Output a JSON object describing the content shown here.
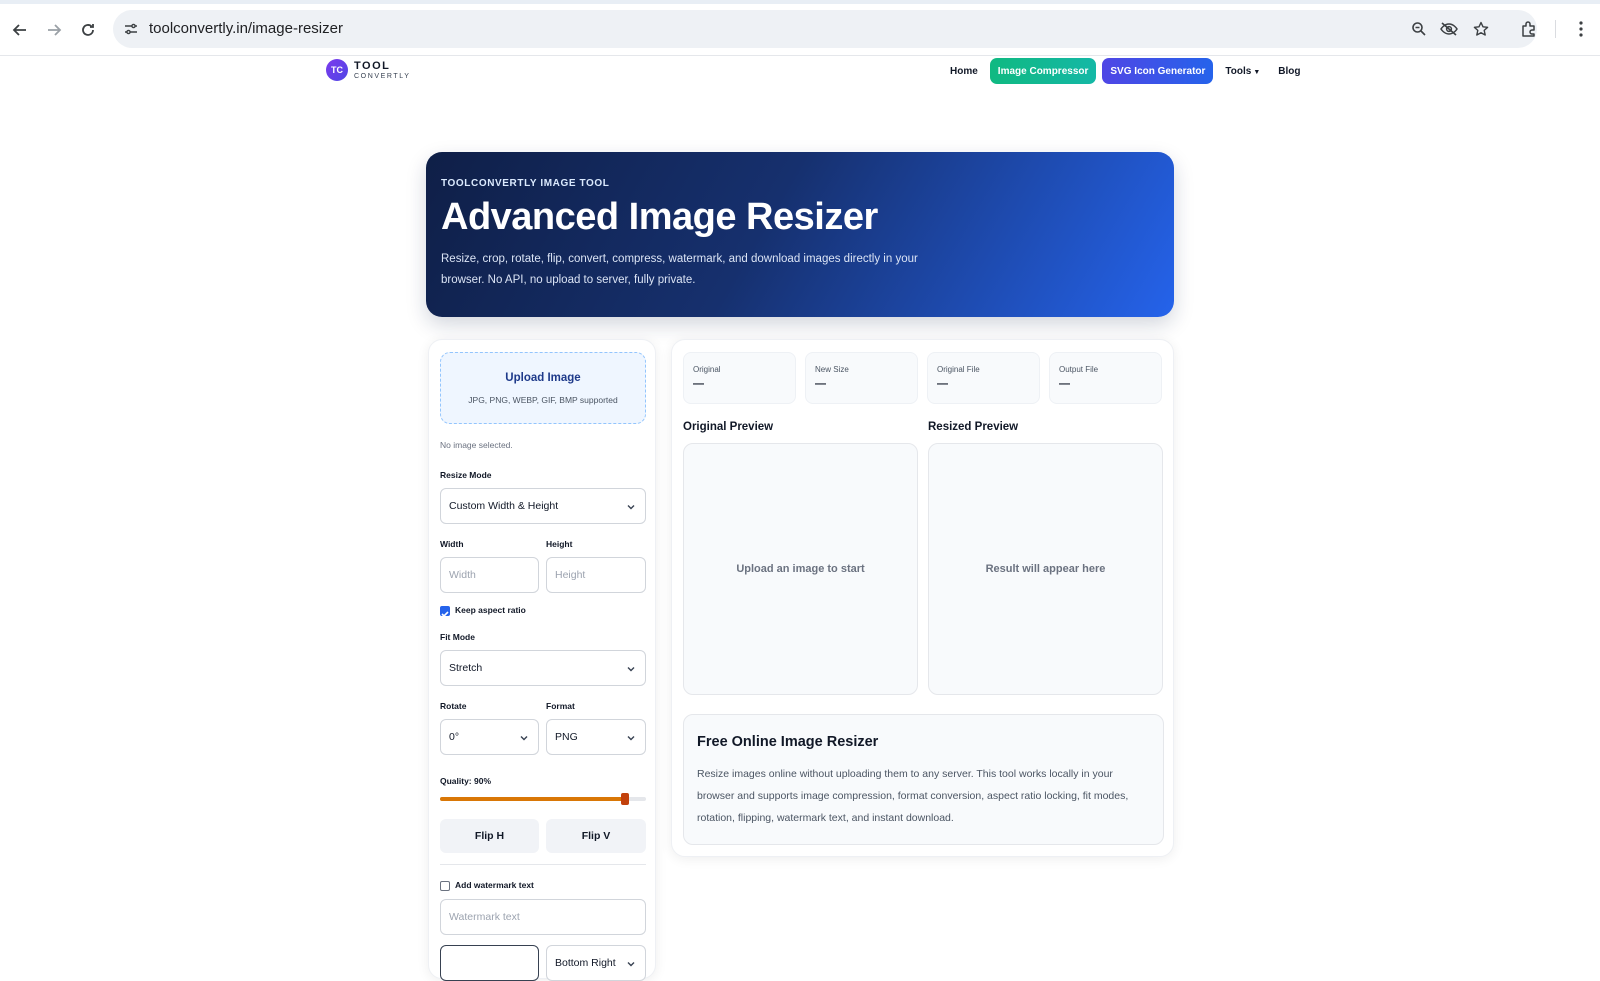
{
  "browser": {
    "url": "toolconvertly.in/image-resizer"
  },
  "site": {
    "logo_mark": "TC",
    "logo_line1": "TOOL",
    "logo_line2": "CONVERTLY",
    "nav": {
      "home": "Home",
      "image_compressor": "Image Compressor",
      "svg_icon_generator": "SVG Icon Generator",
      "tools": "Tools",
      "blog": "Blog"
    }
  },
  "hero": {
    "kicker": "TOOLCONVERTLY IMAGE TOOL",
    "title": "Advanced Image Resizer",
    "description": "Resize, crop, rotate, flip, convert, compress, watermark, and download images directly in your browser. No API, no upload to server, fully private."
  },
  "controls": {
    "upload_title": "Upload Image",
    "upload_sub": "JPG, PNG, WEBP, GIF, BMP supported",
    "no_image": "No image selected.",
    "resize_mode_label": "Resize Mode",
    "resize_mode_value": "Custom Width & Height",
    "width_label": "Width",
    "width_placeholder": "Width",
    "height_label": "Height",
    "height_placeholder": "Height",
    "keep_aspect_label": "Keep aspect ratio",
    "keep_aspect_checked": true,
    "fit_mode_label": "Fit Mode",
    "fit_mode_value": "Stretch",
    "rotate_label": "Rotate",
    "rotate_value": "0°",
    "format_label": "Format",
    "format_value": "PNG",
    "quality_label": "Quality: 90%",
    "quality_fraction": 0.9,
    "flip_h": "Flip H",
    "flip_v": "Flip V",
    "watermark_label": "Add watermark text",
    "watermark_checked": false,
    "watermark_placeholder": "Watermark text",
    "position_value": "Bottom Right"
  },
  "stats": [
    {
      "label": "Original",
      "value": "—"
    },
    {
      "label": "New Size",
      "value": "—"
    },
    {
      "label": "Original File",
      "value": "—"
    },
    {
      "label": "Output File",
      "value": "—"
    }
  ],
  "preview": {
    "original_title": "Original Preview",
    "original_empty": "Upload an image to start",
    "resized_title": "Resized Preview",
    "resized_empty": "Result will appear here"
  },
  "info": {
    "title": "Free Online Image Resizer",
    "body": "Resize images online without uploading them to any server. This tool works locally in your browser and supports image compression, format conversion, aspect ratio locking, fit modes, rotation, flipping, watermark text, and instant download."
  },
  "colors": {
    "accent_blue": "#2563eb",
    "hero_dark": "#0f1f47",
    "pill_green": "#10b981",
    "slider": "#d97706"
  }
}
